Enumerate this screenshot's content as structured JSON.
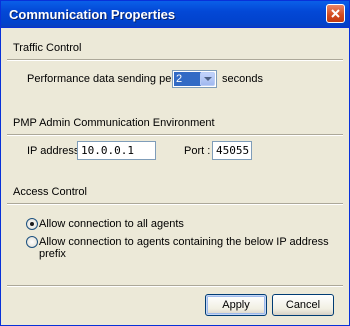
{
  "window": {
    "title": "Communication Properties"
  },
  "traffic": {
    "heading": "Traffic Control",
    "period_label": "Performance data sending period:",
    "period_value": "2",
    "period_unit": "seconds"
  },
  "pmp": {
    "heading": "PMP Admin Communication Environment",
    "ip_label": "IP address:",
    "ip_value": "10.0.0.1",
    "port_label": "Port :",
    "port_value": "45055"
  },
  "access": {
    "heading": "Access Control",
    "option_all": "Allow connection to all agents",
    "option_prefix": "Allow connection to agents containing the below IP address prefix",
    "selected": "option_all"
  },
  "buttons": {
    "apply": "Apply",
    "cancel": "Cancel"
  }
}
